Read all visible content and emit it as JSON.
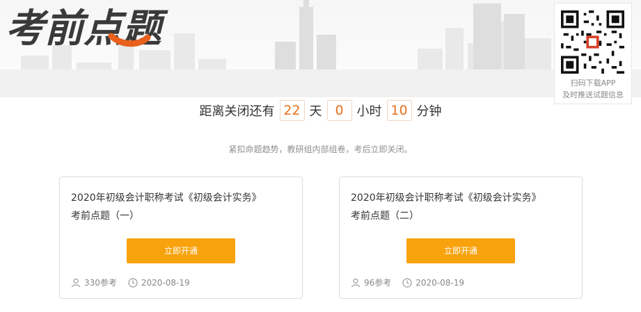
{
  "logo_text": "考前点题",
  "qr": {
    "line1": "扫码下载APP",
    "line2": "及时推送试题信息"
  },
  "countdown": {
    "prefix": "距离关闭还有",
    "days": "22",
    "days_unit": "天",
    "hours": "0",
    "hours_unit": "小时",
    "minutes": "10",
    "minutes_unit": "分钟"
  },
  "subtitle": "紧扣命题趋势，教研组内部组卷，考后立即关闭。",
  "cards": [
    {
      "title_line1": "2020年初级会计职称考试《初级会计实务》",
      "title_line2": "考前点题（一）",
      "button": "立即开通",
      "participants": "330参考",
      "date": "2020-08-19"
    },
    {
      "title_line1": "2020年初级会计职称考试《初级会计实务》",
      "title_line2": "考前点题（二）",
      "button": "立即开通",
      "participants": "96参考",
      "date": "2020-08-19"
    }
  ],
  "colors": {
    "accent": "#f8a20e",
    "countdown_number": "#e8711a",
    "logo_dark": "#3a3a3a",
    "logo_accent": "#e8601c"
  }
}
